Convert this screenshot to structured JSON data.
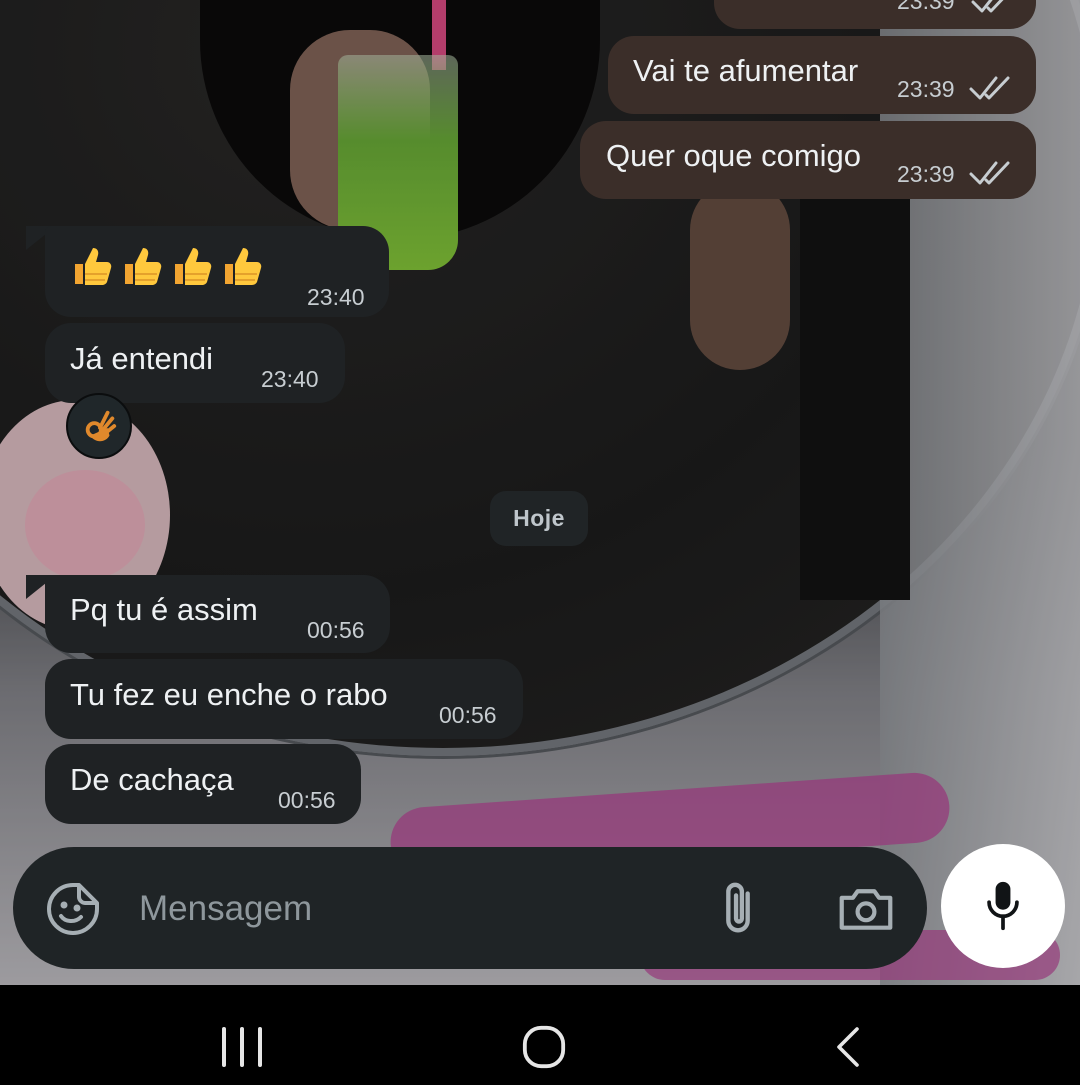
{
  "messages": [
    {
      "direction": "out",
      "text": "",
      "time": "23:39",
      "status": "read"
    },
    {
      "direction": "out",
      "text": "Vai te afumentar",
      "time": "23:39",
      "status": "read"
    },
    {
      "direction": "out",
      "text": "Quer oque comigo",
      "time": "23:39",
      "status": "read"
    },
    {
      "direction": "in",
      "text": "👍👍👍👍",
      "time": "23:40"
    },
    {
      "direction": "in",
      "text": "Já entendi",
      "time": "23:40",
      "reaction": "👌"
    },
    {
      "direction": "in",
      "text": "Pq tu é assim",
      "time": "00:56"
    },
    {
      "direction": "in",
      "text": "Tu fez eu enche o rabo",
      "time": "00:56"
    },
    {
      "direction": "in",
      "text": "De cachaça",
      "time": "00:56"
    }
  ],
  "date_separator": "Hoje",
  "composer": {
    "placeholder": "Mensagem",
    "icons": [
      "sticker-icon",
      "paperclip-icon",
      "camera-icon",
      "microphone-icon"
    ]
  },
  "system_nav": {
    "buttons": [
      "recent-apps-icon",
      "home-icon",
      "back-icon"
    ]
  },
  "colors": {
    "outgoing_bubble": "#3b2e29",
    "incoming_bubble": "#1f2224",
    "composer": "#1f2426",
    "mic_button": "#ffffff"
  }
}
